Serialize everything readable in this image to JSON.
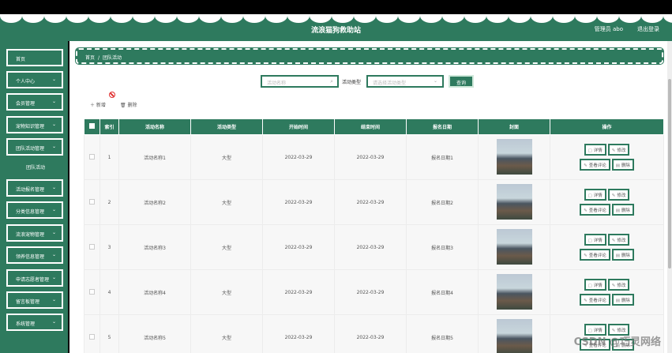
{
  "header": {
    "title": "流浪猫狗救助站",
    "user_text": "管理员 abo",
    "logout": "退出登录"
  },
  "sidebar": {
    "items": [
      {
        "label": "首页",
        "chevron": false
      },
      {
        "label": "个人中心",
        "chevron": true
      },
      {
        "label": "会员管理",
        "chevron": true
      },
      {
        "label": "宠物知识管理",
        "chevron": true
      },
      {
        "label": "团队活动管理",
        "chevron": true
      },
      {
        "label": "活动报名管理",
        "chevron": true
      },
      {
        "label": "分类信息管理",
        "chevron": true
      },
      {
        "label": "流浪宠物管理",
        "chevron": true
      },
      {
        "label": "领养信息管理",
        "chevron": true
      },
      {
        "label": "申请志愿者管理",
        "chevron": true
      },
      {
        "label": "留言板管理",
        "chevron": true
      },
      {
        "label": "系统管理",
        "chevron": true
      }
    ],
    "sub_item": "团队活动"
  },
  "breadcrumb": {
    "home": "首页",
    "sep": "/",
    "current": "团队活动"
  },
  "search": {
    "name_placeholder": "活动名称",
    "type_label": "活动类型",
    "type_placeholder": "请选择活动类型",
    "query_button": "查询"
  },
  "actions": {
    "add": "新增",
    "delete": "删除"
  },
  "table": {
    "headers": [
      "索引",
      "活动名称",
      "活动类型",
      "开始时间",
      "结束时间",
      "报名日期",
      "封面",
      "操作"
    ],
    "rows": [
      {
        "index": "1",
        "name": "活动名称1",
        "type": "大型",
        "start": "2022-03-29",
        "end": "2022-03-29",
        "date": "报名日期1"
      },
      {
        "index": "2",
        "name": "活动名称2",
        "type": "大型",
        "start": "2022-03-29",
        "end": "2022-03-29",
        "date": "报名日期2"
      },
      {
        "index": "3",
        "name": "活动名称3",
        "type": "大型",
        "start": "2022-03-29",
        "end": "2022-03-29",
        "date": "报名日期3"
      },
      {
        "index": "4",
        "name": "活动名称4",
        "type": "大型",
        "start": "2022-03-29",
        "end": "2022-03-29",
        "date": "报名日期4"
      },
      {
        "index": "5",
        "name": "活动名称5",
        "type": "大型",
        "start": "2022-03-29",
        "end": "2022-03-29",
        "date": "报名日期5"
      }
    ],
    "ops": {
      "detail": "详情",
      "edit": "修改",
      "comments": "查看评论",
      "delete": "删除"
    }
  },
  "watermark": "CSDN @巧灵网络",
  "colors": {
    "primary": "#2e7a5e",
    "danger": "#e03030"
  }
}
